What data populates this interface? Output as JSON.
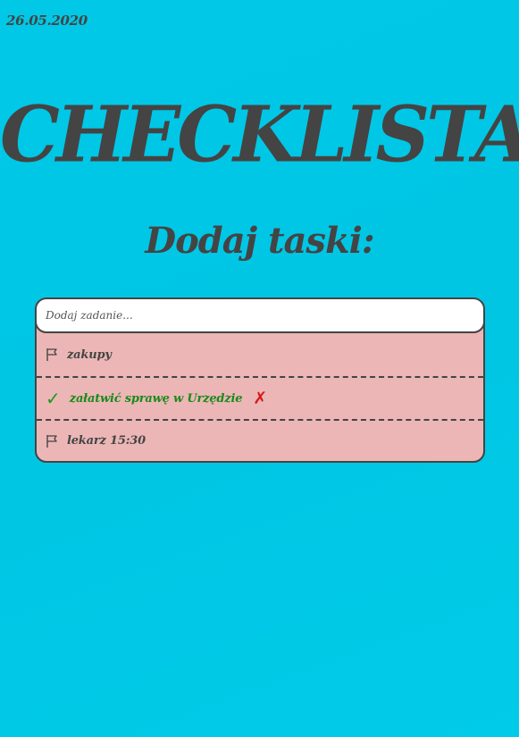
{
  "date": "26.05.2020",
  "title": "CHECKLISTA",
  "subtitle": "Dodaj taski:",
  "input": {
    "placeholder": "Dodaj zadanie...",
    "value": ""
  },
  "tasks": [
    {
      "label": "zakupy",
      "status": "pending",
      "icon": "flag-icon"
    },
    {
      "label": "załatwić sprawę w Urzędzie",
      "status": "done",
      "icon": "check-icon",
      "delete_icon": "cross-icon"
    },
    {
      "label": "lekarz 15:30",
      "status": "pending",
      "icon": "flag-icon"
    }
  ],
  "colors": {
    "background": "#00c8e6",
    "text": "#444444",
    "list_background": "#ecb6b6",
    "done_text": "#1a8a1a",
    "delete": "#d81818"
  },
  "glyphs": {
    "check": "✓",
    "delete": "✗"
  }
}
